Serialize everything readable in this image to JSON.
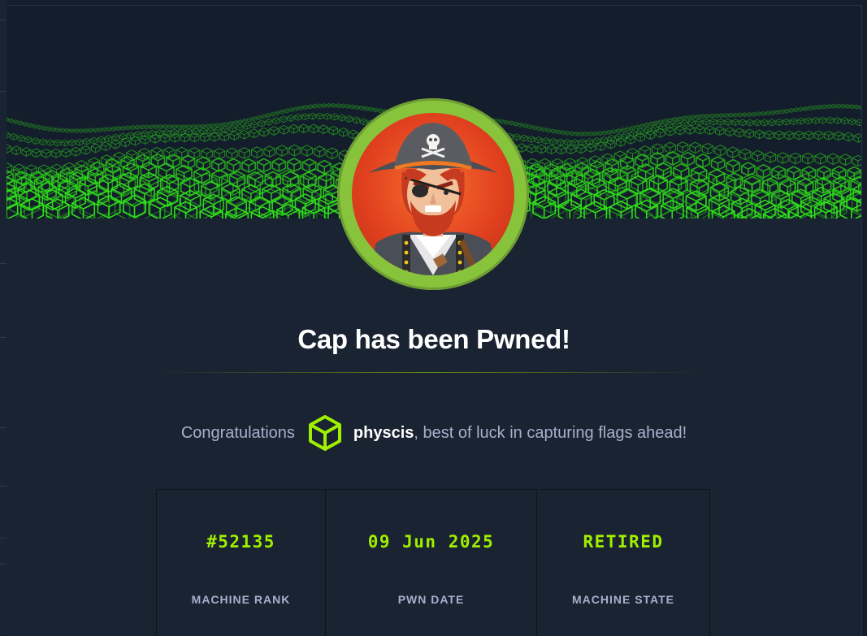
{
  "modal": {
    "title": "Cap has been Pwned!",
    "congrats_prefix": "Congratulations",
    "username": "physcis",
    "congrats_suffix": ", best of luck in capturing flags ahead!",
    "avatar_icon": "pirate-avatar",
    "user_icon": "cube-icon"
  },
  "stats": [
    {
      "value": "#52135",
      "label": "MACHINE RANK"
    },
    {
      "value": "09 Jun 2025",
      "label": "PWN DATE"
    },
    {
      "value": "RETIRED",
      "label": "MACHINE STATE"
    }
  ],
  "colors": {
    "accent": "#9fef00",
    "background": "#1a2332",
    "text_muted": "#a4b1cd",
    "avatar_ring": "#87c43c"
  }
}
